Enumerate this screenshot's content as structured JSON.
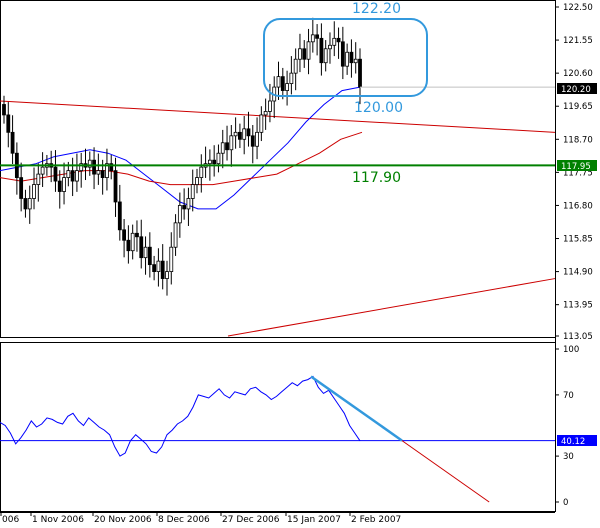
{
  "chart_data": [
    {
      "type": "candlestick",
      "panel": "price",
      "ylim": [
        113.05,
        122.5
      ],
      "y_ticks": [
        "122.50",
        "121.55",
        "120.60",
        "119.65",
        "118.70",
        "117.75",
        "116.80",
        "115.85",
        "114.90",
        "113.95",
        "113.05"
      ],
      "x_ticks": [
        "006",
        "1 Nov 2006",
        "20 Nov 2006",
        "8 Dec 2006",
        "27 Dec 2006",
        "15 Jan 2007",
        "2 Feb 2007"
      ],
      "current_price_label": "120.20",
      "horizontal_line": {
        "value": 117.95,
        "label": "117.95",
        "color": "#008000"
      },
      "annotations": [
        {
          "text": "122.20",
          "value": 122.2,
          "color": "#3399dd"
        },
        {
          "text": "120.00",
          "value": 120.0,
          "color": "#3399dd"
        },
        {
          "text": "117.90",
          "value": 117.9,
          "color": "#008000"
        }
      ],
      "closes": [
        119.4,
        118.9,
        118.3,
        117.6,
        117.0,
        116.7,
        117.0,
        117.4,
        117.7,
        117.9,
        118.0,
        117.9,
        117.5,
        117.2,
        117.6,
        117.8,
        117.5,
        117.8,
        118.0,
        117.9,
        118.1,
        117.7,
        117.8,
        117.6,
        118.0,
        117.8,
        116.9,
        116.1,
        115.8,
        115.5,
        116.0,
        115.9,
        115.3,
        115.6,
        115.1,
        114.9,
        115.2,
        114.7,
        114.9,
        115.6,
        116.3,
        116.8,
        116.7,
        117.0,
        117.4,
        117.6,
        117.9,
        118.0,
        118.1,
        118.0,
        118.3,
        118.6,
        118.4,
        118.8,
        118.9,
        118.7,
        119.0,
        118.8,
        118.5,
        118.9,
        119.4,
        119.5,
        119.8,
        120.2,
        120.5,
        120.1,
        120.3,
        120.6,
        121.0,
        121.3,
        121.0,
        121.5,
        121.7,
        121.6,
        120.9,
        121.3,
        121.4,
        121.6,
        121.5,
        120.8,
        121.2,
        120.9,
        121.0,
        120.2
      ],
      "series": [
        {
          "name": "",
          "color": "#0000ff",
          "values": [
            117.8,
            117.9,
            118.0,
            118.2,
            118.3,
            118.4,
            118.3,
            118.1,
            117.7,
            117.3,
            116.9,
            116.7,
            116.7,
            117.1,
            117.6,
            118.1,
            118.6,
            119.2,
            119.7,
            120.1,
            120.2
          ]
        },
        {
          "name": "",
          "color": "#cc0000",
          "values": [
            117.6,
            117.5,
            117.6,
            117.7,
            117.8,
            117.8,
            117.7,
            117.5,
            117.4,
            117.4,
            117.4,
            117.5,
            117.6,
            117.7,
            118.0,
            118.3,
            118.7,
            118.9
          ]
        }
      ],
      "trendlines": [
        {
          "color": "#cc0000",
          "from": {
            "x": "start",
            "y": 119.8
          },
          "to": {
            "x": "end",
            "y": 118.9
          }
        },
        {
          "color": "#cc0000",
          "from": {
            "x": "27 Dec 2006",
            "y": 113.05
          },
          "to": {
            "x": "end",
            "y": 114.7
          }
        }
      ]
    },
    {
      "type": "line",
      "panel": "oscillator",
      "ylim": [
        0,
        100
      ],
      "y_ticks": [
        "100",
        "70",
        "30",
        "0"
      ],
      "current_value_label": "40.12",
      "horizontal_line": {
        "value": 40.12,
        "color": "#0000ff"
      },
      "values": [
        52,
        50,
        45,
        38,
        42,
        47,
        53,
        49,
        51,
        55,
        54,
        52,
        51,
        56,
        58,
        53,
        50,
        55,
        52,
        49,
        47,
        44,
        36,
        30,
        32,
        40,
        44,
        41,
        38,
        33,
        32,
        36,
        44,
        47,
        51,
        53,
        56,
        62,
        70,
        69,
        68,
        71,
        74,
        70,
        68,
        72,
        71,
        70,
        74,
        75,
        72,
        70,
        67,
        69,
        72,
        75,
        78,
        76,
        79,
        80,
        82,
        75,
        71,
        73,
        68,
        63,
        58,
        50,
        45,
        40
      ],
      "trendline": {
        "color": "#3399dd",
        "from": {
          "x": "15 Jan 2007",
          "y": 82
        },
        "to": {
          "x": "future",
          "y": 40.12
        }
      },
      "extension_line": {
        "color": "#cc0000",
        "from": {
          "y": 40.12
        },
        "to": {
          "y": 0
        }
      }
    }
  ]
}
